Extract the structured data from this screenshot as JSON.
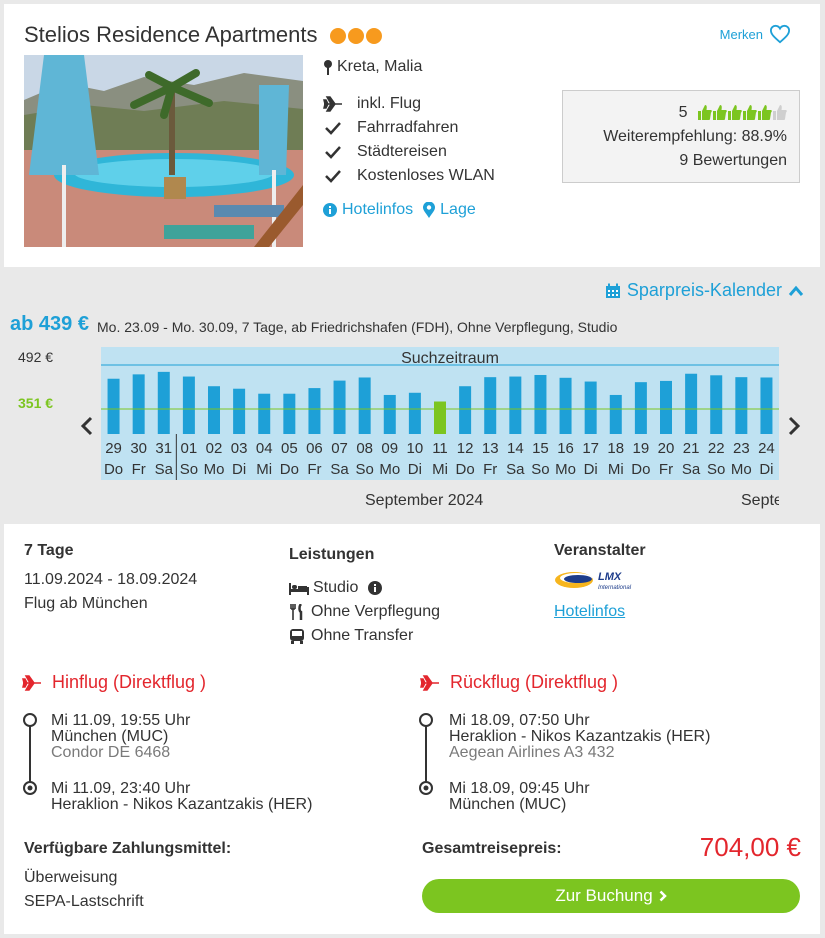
{
  "hotel": {
    "name": "Stelios Residence Apartments",
    "stars": 3,
    "merken_label": "Merken",
    "location": "Kreta, Malia",
    "features": [
      "inkl. Flug",
      "Fahrradfahren",
      "Städtereisen",
      "Kostenloses WLAN"
    ],
    "links": {
      "hotelinfos": "Hotelinfos",
      "lage": "Lage"
    },
    "rating": {
      "score": "5",
      "thumbs_full": 5,
      "thumbs_empty": 1,
      "recommendation": "Weiterempfehlung: 88.9%",
      "reviews": "9 Bewertungen"
    }
  },
  "calendar": {
    "toggle_label": "Sparpreis-Kalender",
    "from_price": "ab 439 €",
    "summary": "Mo. 23.09 - Mo. 30.09, 7 Tage, ab Friedrichshafen (FDH), Ohne Verpflegung, Studio",
    "price_high": "492 €",
    "price_low": "351 €",
    "range_label": "Suchzeitraum",
    "month_label": "September 2024",
    "month_label_next": "Septe"
  },
  "chart_data": {
    "type": "bar",
    "categories": [
      "29",
      "30",
      "31",
      "01",
      "02",
      "03",
      "04",
      "05",
      "06",
      "07",
      "08",
      "09",
      "10",
      "11",
      "12",
      "13",
      "14",
      "15",
      "16",
      "17",
      "18",
      "19",
      "20",
      "21",
      "22",
      "23",
      "24"
    ],
    "weekdays": [
      "Do",
      "Fr",
      "Sa",
      "So",
      "Mo",
      "Di",
      "Mi",
      "Do",
      "Fr",
      "Sa",
      "So",
      "Mo",
      "Di",
      "Mi",
      "Do",
      "Fr",
      "Sa",
      "So",
      "Mo",
      "Di",
      "Mi",
      "Do",
      "Fr",
      "Sa",
      "So",
      "Mo",
      "Di"
    ],
    "values": [
      448,
      462,
      470,
      455,
      424,
      416,
      400,
      400,
      418,
      442,
      452,
      396,
      403,
      375,
      424,
      453,
      455,
      460,
      451,
      439,
      396,
      437,
      441,
      464,
      459,
      453,
      452
    ],
    "highlight_index": 13,
    "reference_lines": [
      492,
      351
    ],
    "colors": {
      "bar": "#1ea0d7",
      "highlight": "#7cc520",
      "band": "#bfe2f2",
      "low_line": "#7cc520",
      "high_line": "#1ea0d7"
    }
  },
  "offer": {
    "duration": "7 Tage",
    "dates": "11.09.2024 - 18.09.2024",
    "departure": "Flug ab München",
    "leistungen_title": "Leistungen",
    "leistungen": [
      "Studio",
      "Ohne Verpflegung",
      "Ohne Transfer"
    ],
    "veranstalter_title": "Veranstalter",
    "veranstalter_logo": "LMX",
    "veranstalter_logo_sub": "International",
    "veranstalter_link": "Hotelinfos"
  },
  "flights": {
    "outbound": {
      "title": "Hinflug (Direktflug )",
      "dep_time": "Mi 11.09, 19:55 Uhr",
      "dep_airport": "München (MUC)",
      "carrier": "Condor DE 6468",
      "arr_time": "Mi 11.09, 23:40 Uhr",
      "arr_airport": "Heraklion - Nikos Kazantzakis (HER)"
    },
    "return": {
      "title": "Rückflug (Direktflug )",
      "dep_time": "Mi 18.09, 07:50 Uhr",
      "dep_airport": "Heraklion - Nikos Kazantzakis (HER)",
      "carrier": "Aegean Airlines A3 432",
      "arr_time": "Mi 18.09, 09:45 Uhr",
      "arr_airport": "München (MUC)"
    }
  },
  "payment": {
    "title": "Verfügbare Zahlungsmittel:",
    "methods": [
      "Überweisung",
      "SEPA-Lastschrift"
    ]
  },
  "total": {
    "label": "Gesamtreisepreis:",
    "price": "704,00 €",
    "button": "Zur Buchung"
  },
  "colors": {
    "accent": "#1ea0d7",
    "green": "#7cc520",
    "red": "#e3262d",
    "orange": "#f79a1e"
  }
}
